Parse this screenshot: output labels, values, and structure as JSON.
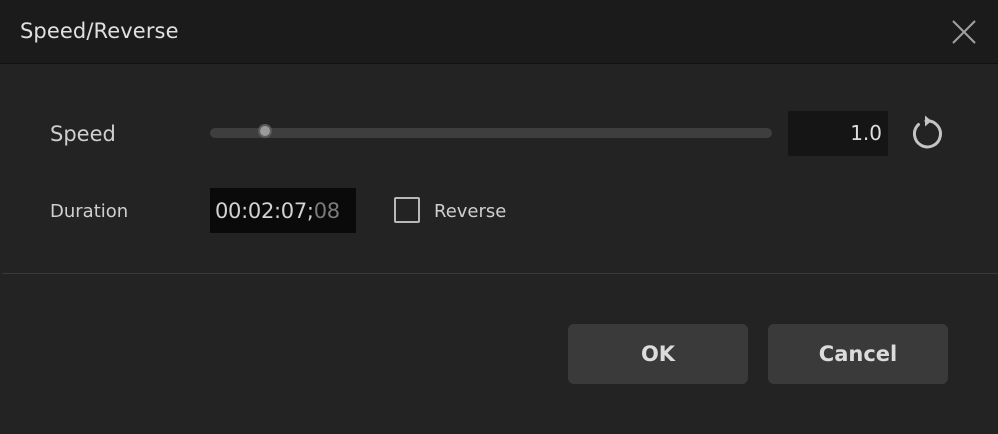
{
  "dialog": {
    "title": "Speed/Reverse"
  },
  "speed": {
    "label": "Speed",
    "value": "1.0",
    "slider_level": 0.1
  },
  "duration": {
    "label": "Duration",
    "time": "00:02:07;",
    "frames": "08"
  },
  "reverse": {
    "label": "Reverse",
    "checked": false
  },
  "buttons": {
    "ok": "OK",
    "cancel": "Cancel"
  },
  "icons": {
    "close": "close-icon",
    "reset": "reset-icon"
  }
}
